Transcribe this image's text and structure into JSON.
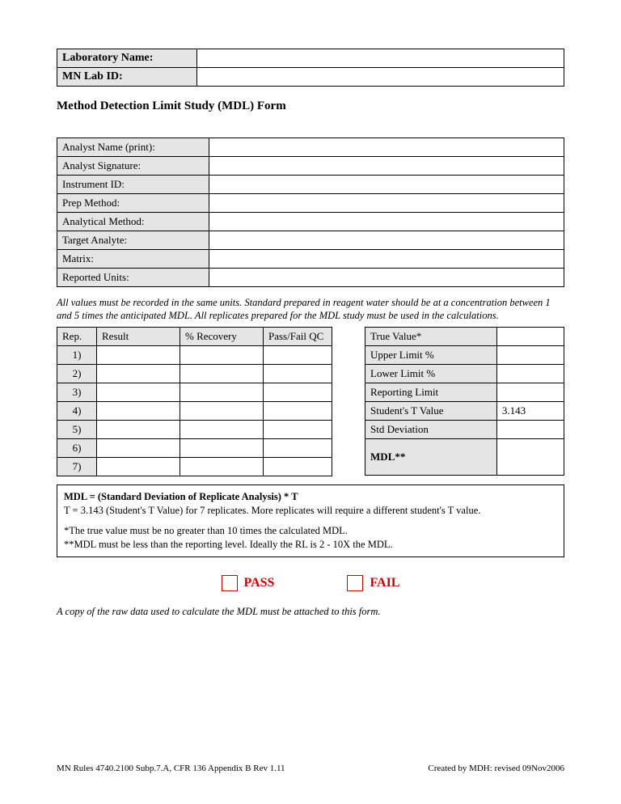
{
  "header": {
    "lab_name_label": "Laboratory Name:",
    "lab_name_value": "",
    "mn_lab_id_label": "MN Lab ID:",
    "mn_lab_id_value": ""
  },
  "title": "Method Detection Limit Study (MDL) Form",
  "info": {
    "rows": [
      {
        "label": "Analyst Name (print):",
        "value": ""
      },
      {
        "label": "Analyst Signature:",
        "value": ""
      },
      {
        "label": "Instrument ID:",
        "value": ""
      },
      {
        "label": "Prep Method:",
        "value": ""
      },
      {
        "label": "Analytical Method:",
        "value": ""
      },
      {
        "label": "Target Analyte:",
        "value": ""
      },
      {
        "label": "Matrix:",
        "value": ""
      },
      {
        "label": "Reported Units:",
        "value": ""
      }
    ]
  },
  "note": "All values must be recorded in the same units.  Standard prepared in reagent water should be at a concentration between 1 and 5 times the anticipated MDL.  All replicates prepared for the MDL study must be used in the calculations.",
  "rep_table": {
    "headers": {
      "rep": "Rep.",
      "result": "Result",
      "recovery": "% Recovery",
      "qc": "Pass/Fail QC"
    },
    "rows": [
      {
        "n": "1)",
        "result": "",
        "recovery": "",
        "qc": ""
      },
      {
        "n": "2)",
        "result": "",
        "recovery": "",
        "qc": ""
      },
      {
        "n": "3)",
        "result": "",
        "recovery": "",
        "qc": ""
      },
      {
        "n": "4)",
        "result": "",
        "recovery": "",
        "qc": ""
      },
      {
        "n": "5)",
        "result": "",
        "recovery": "",
        "qc": ""
      },
      {
        "n": "6)",
        "result": "",
        "recovery": "",
        "qc": ""
      },
      {
        "n": "7)",
        "result": "",
        "recovery": "",
        "qc": ""
      }
    ]
  },
  "vals_table": {
    "rows": [
      {
        "label": "True Value*",
        "value": ""
      },
      {
        "label": "Upper Limit %",
        "value": ""
      },
      {
        "label": "Lower Limit %",
        "value": ""
      },
      {
        "label": "Reporting Limit",
        "value": ""
      },
      {
        "label": "Student's T Value",
        "value": "3.143"
      },
      {
        "label": "Std Deviation",
        "value": ""
      },
      {
        "label": "MDL**",
        "value": "",
        "bold": true,
        "tall": true
      }
    ]
  },
  "formula": {
    "line1": "MDL = (Standard Deviation of Replicate Analysis) *  T",
    "line2": "T = 3.143 (Student's T Value) for 7 replicates.  More replicates will require a different student's T value.",
    "line3": "*The true value must be no greater than 10 times the calculated MDL.",
    "line4": "**MDL must be less than the reporting level.  Ideally the RL is 2 - 10X the MDL."
  },
  "passfail": {
    "pass": "PASS",
    "fail": "FAIL"
  },
  "attach_note": "A copy of the raw data used to calculate the MDL must be attached to this form.",
  "footer": {
    "left": "MN Rules 4740.2100 Subp.7.A, CFR 136 Appendix B Rev 1.11",
    "right": "Created by MDH: revised 09Nov2006"
  }
}
